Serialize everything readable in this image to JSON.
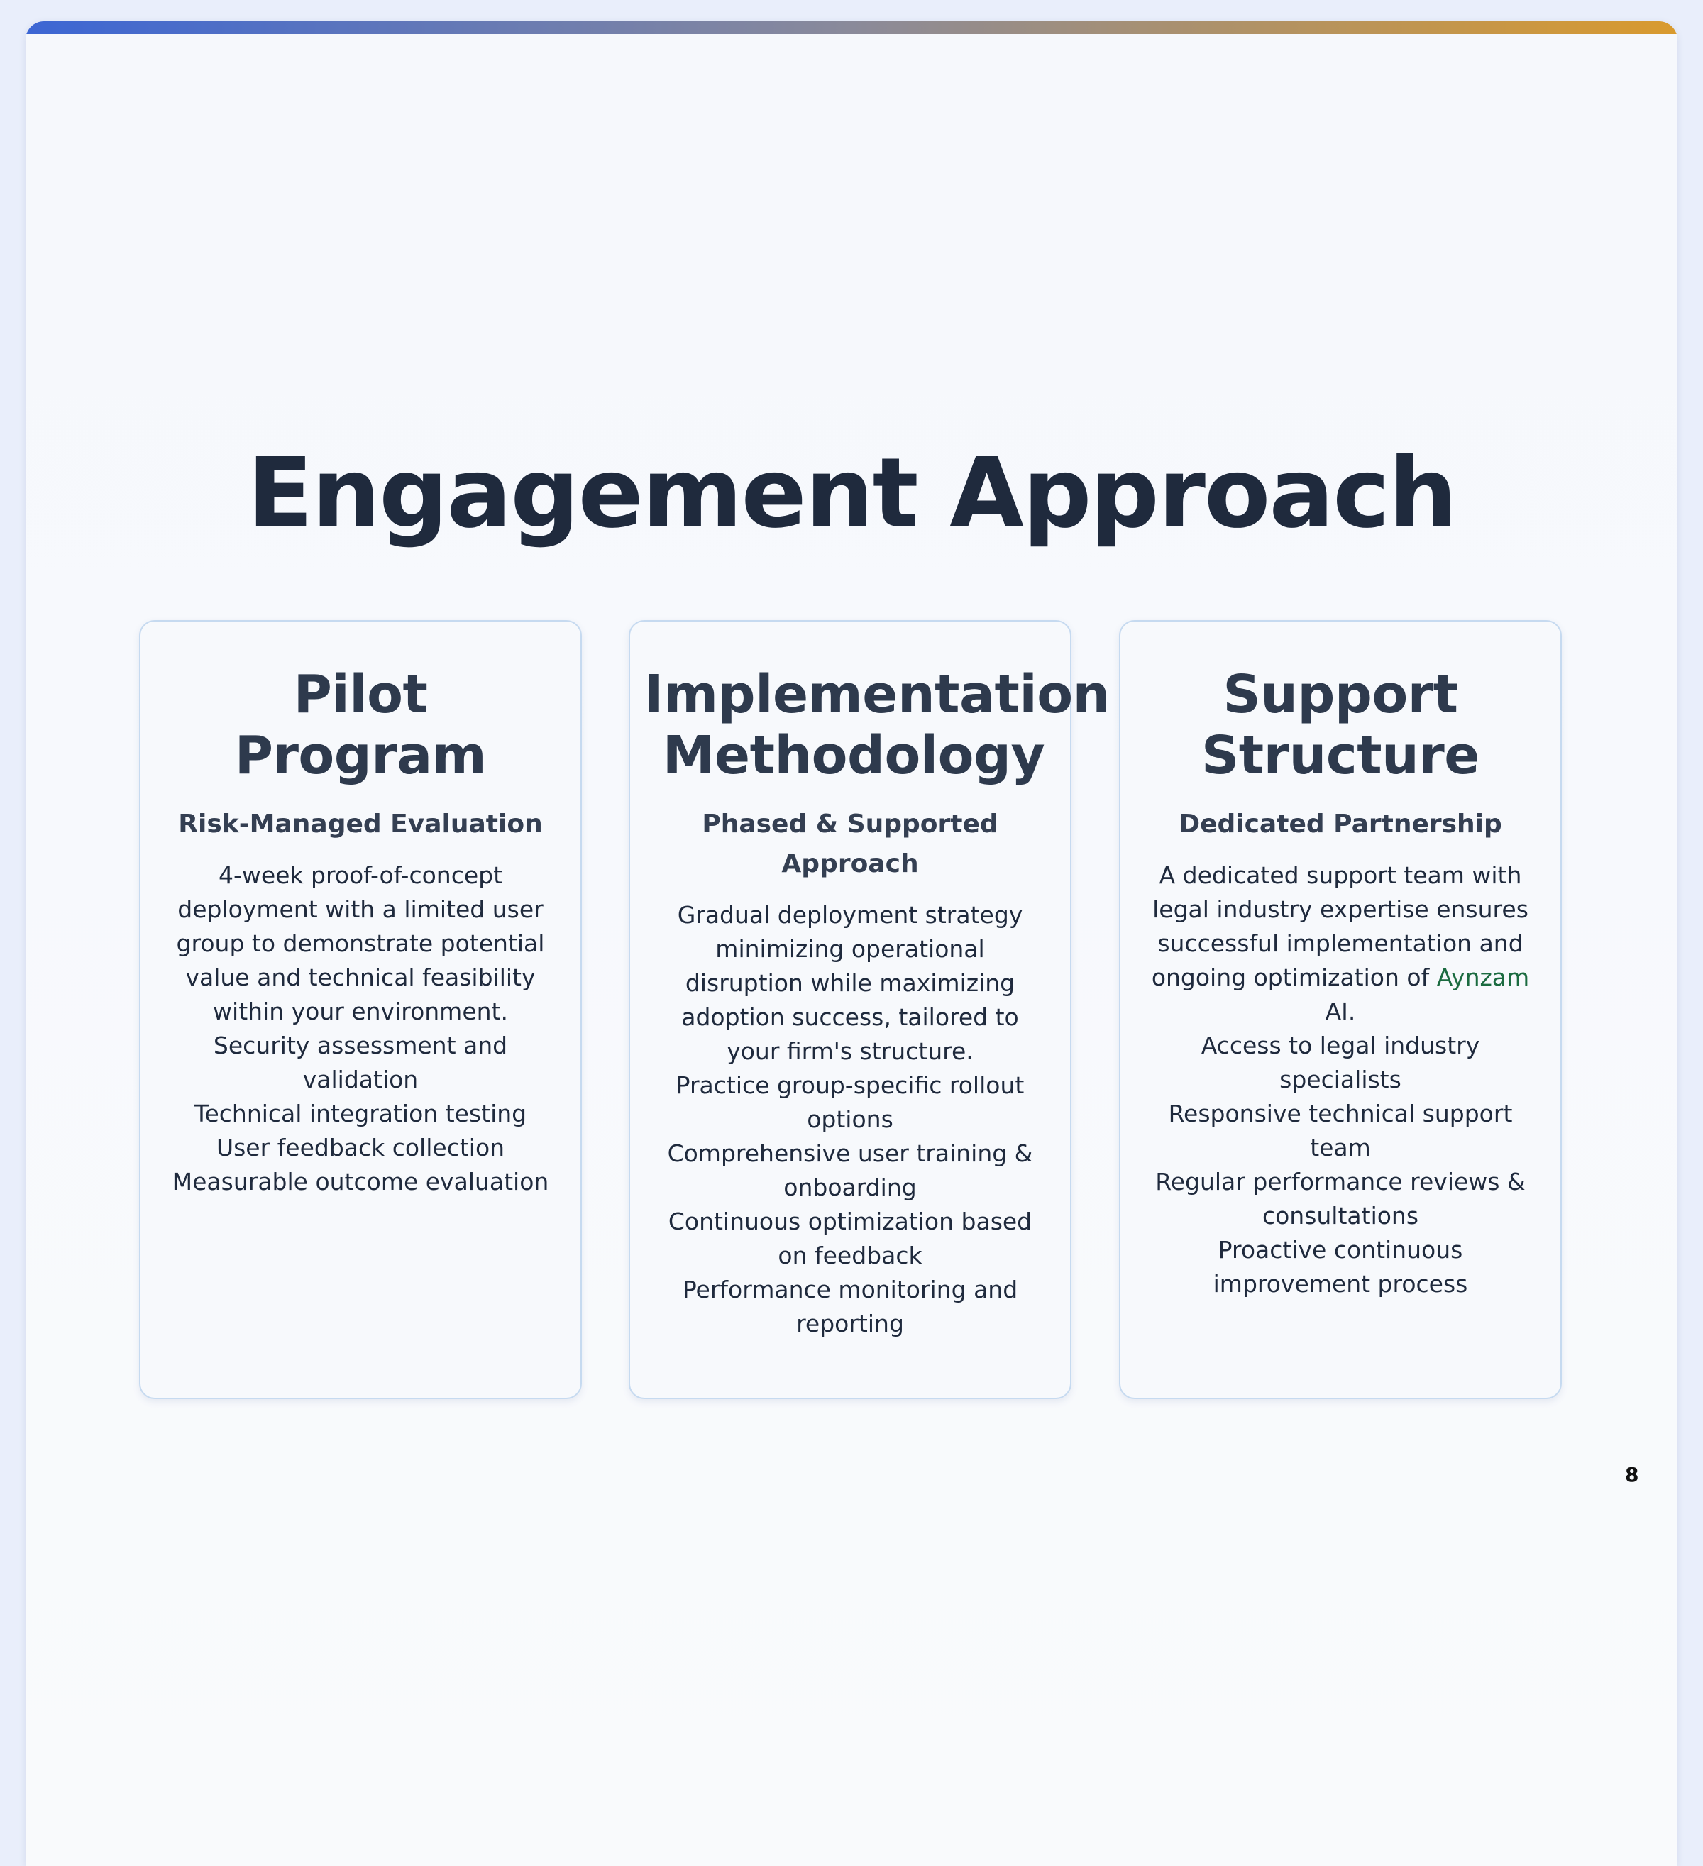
{
  "colors": {
    "accent_start": "#3c66d4",
    "accent_mid": "#8a8a9a",
    "accent_end": "#d99a2e",
    "brand": "#1b6b40",
    "title": "#1f2a3d",
    "card_border": "#c6daf0"
  },
  "slide": {
    "title": "Engagement Approach",
    "page_number": "8"
  },
  "cards": [
    {
      "title": "Pilot Program",
      "subtitle": "Risk-Managed Evaluation",
      "description": "4-week proof-of-concept deployment with a limited user group to demonstrate potential value and technical feasibility within your environment.",
      "items": [
        "Security assessment and validation",
        "Technical integration testing",
        "User feedback collection",
        "Measurable outcome evaluation"
      ]
    },
    {
      "title": "Implementation Methodology",
      "subtitle": "Phased & Supported Approach",
      "description": "Gradual deployment strategy minimizing operational disruption while maximizing adoption success, tailored to your firm's structure.",
      "items": [
        "Practice group-specific rollout options",
        "Comprehensive user training & onboarding",
        "Continuous optimization based on feedback",
        "Performance monitoring and reporting"
      ]
    },
    {
      "title": "Support Structure",
      "subtitle": "Dedicated Partnership",
      "description_before": "A dedicated support team with legal industry expertise ensures successful implementation and ongoing optimization of",
      "brand_name": "Aynzam",
      "description_after": "AI.",
      "items": [
        "Access to legal industry specialists",
        "Responsive technical support team",
        "Regular performance reviews & consultations",
        "Proactive continuous improvement process"
      ]
    }
  ]
}
